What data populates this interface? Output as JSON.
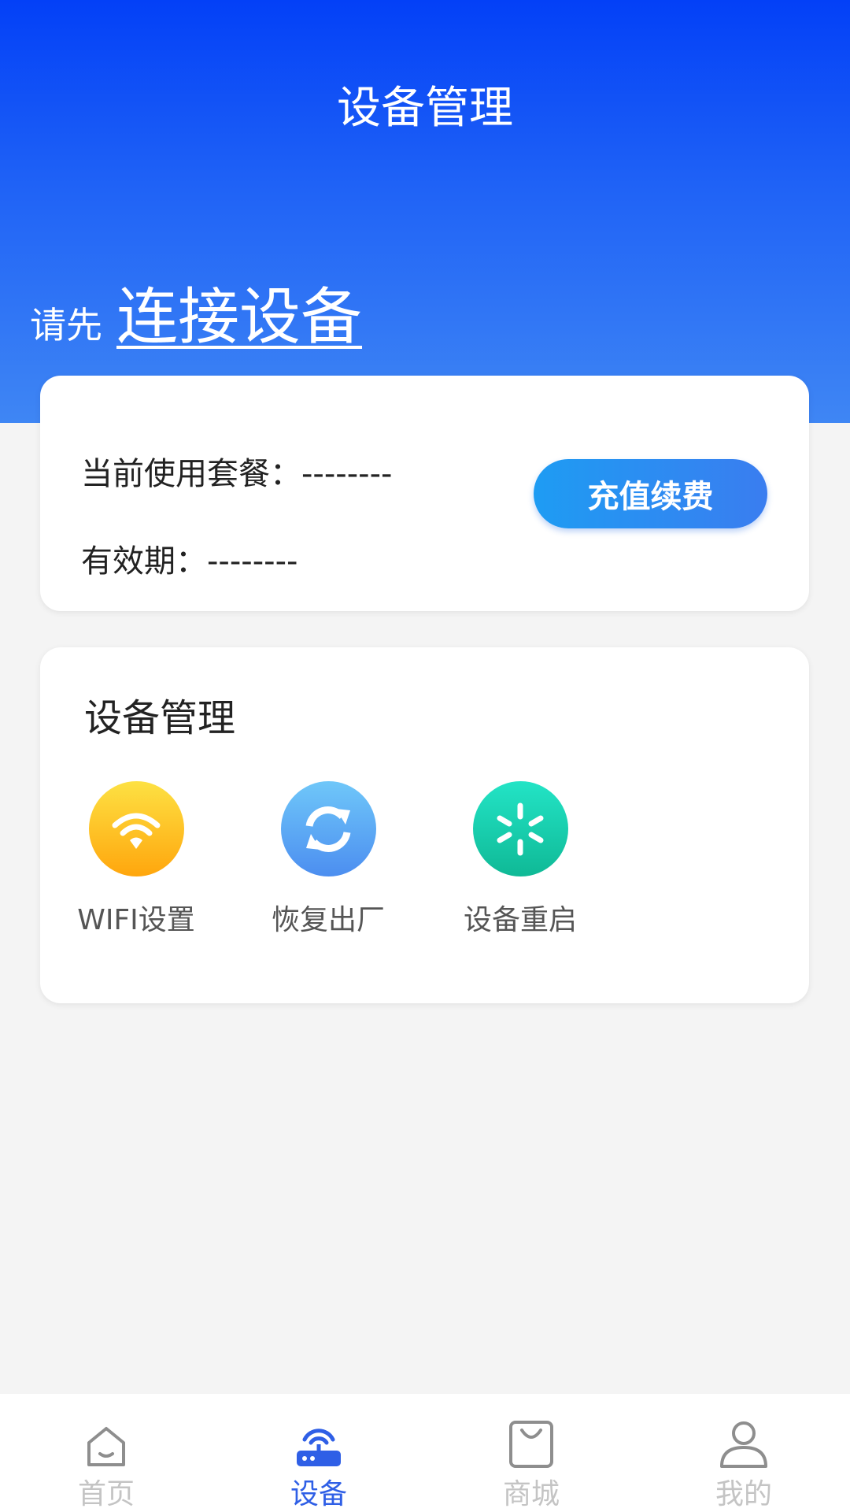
{
  "header": {
    "title": "设备管理",
    "connect_prefix": "请先",
    "connect_link": "连接设备"
  },
  "plan": {
    "current_plan": "当前使用套餐：--------",
    "validity": "有效期：--------",
    "recharge_button": "充值续费"
  },
  "device_management": {
    "title": "设备管理",
    "tools": [
      {
        "label": "WIFI设置",
        "icon": "wifi-icon"
      },
      {
        "label": "恢复出厂",
        "icon": "refresh-icon"
      },
      {
        "label": "设备重启",
        "icon": "restart-icon"
      }
    ]
  },
  "tabbar": {
    "items": [
      {
        "label": "首页",
        "icon": "home-icon"
      },
      {
        "label": "设备",
        "icon": "router-icon"
      },
      {
        "label": "商城",
        "icon": "shopping-bag-icon"
      },
      {
        "label": "我的",
        "icon": "user-icon"
      }
    ],
    "active_color": "#2f5fe6",
    "inactive_color": "#c4c4c4"
  },
  "colors": {
    "header_top": "#0340f7",
    "header_bottom": "#3f86f4"
  }
}
